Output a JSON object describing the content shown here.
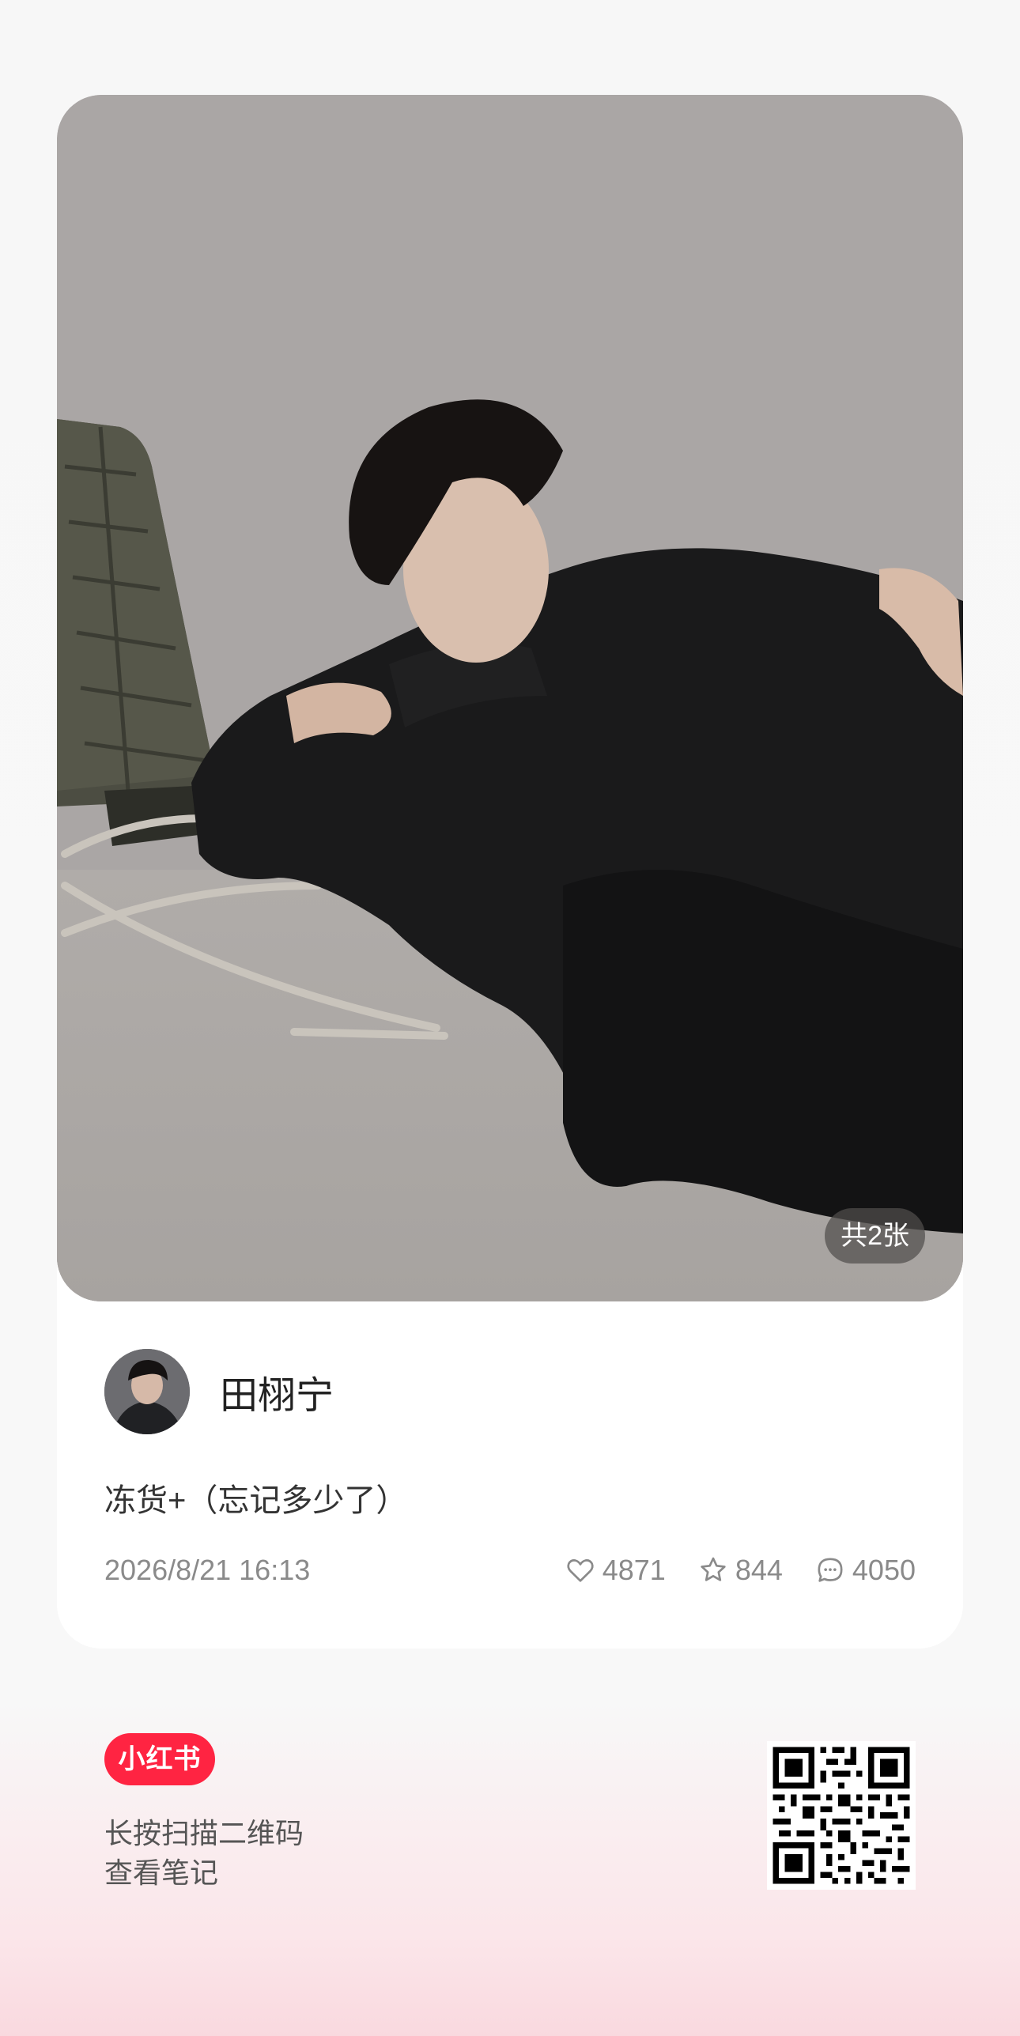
{
  "post": {
    "image_count_label": "共2张",
    "author_name": "田栩宁",
    "caption": "冻货+（忘记多少了）",
    "date": "2026/8/21 16:13",
    "likes": "4871",
    "favorites": "844",
    "comments": "4050"
  },
  "footer": {
    "logo_text": "小红书",
    "hint_line1": "长按扫描二维码",
    "hint_line2": "查看笔记"
  },
  "colors": {
    "brand_red": "#ff2442",
    "meta_gray": "#8a8a8a"
  },
  "icons": [
    "heart-icon",
    "star-icon",
    "comment-icon",
    "qr-code"
  ]
}
